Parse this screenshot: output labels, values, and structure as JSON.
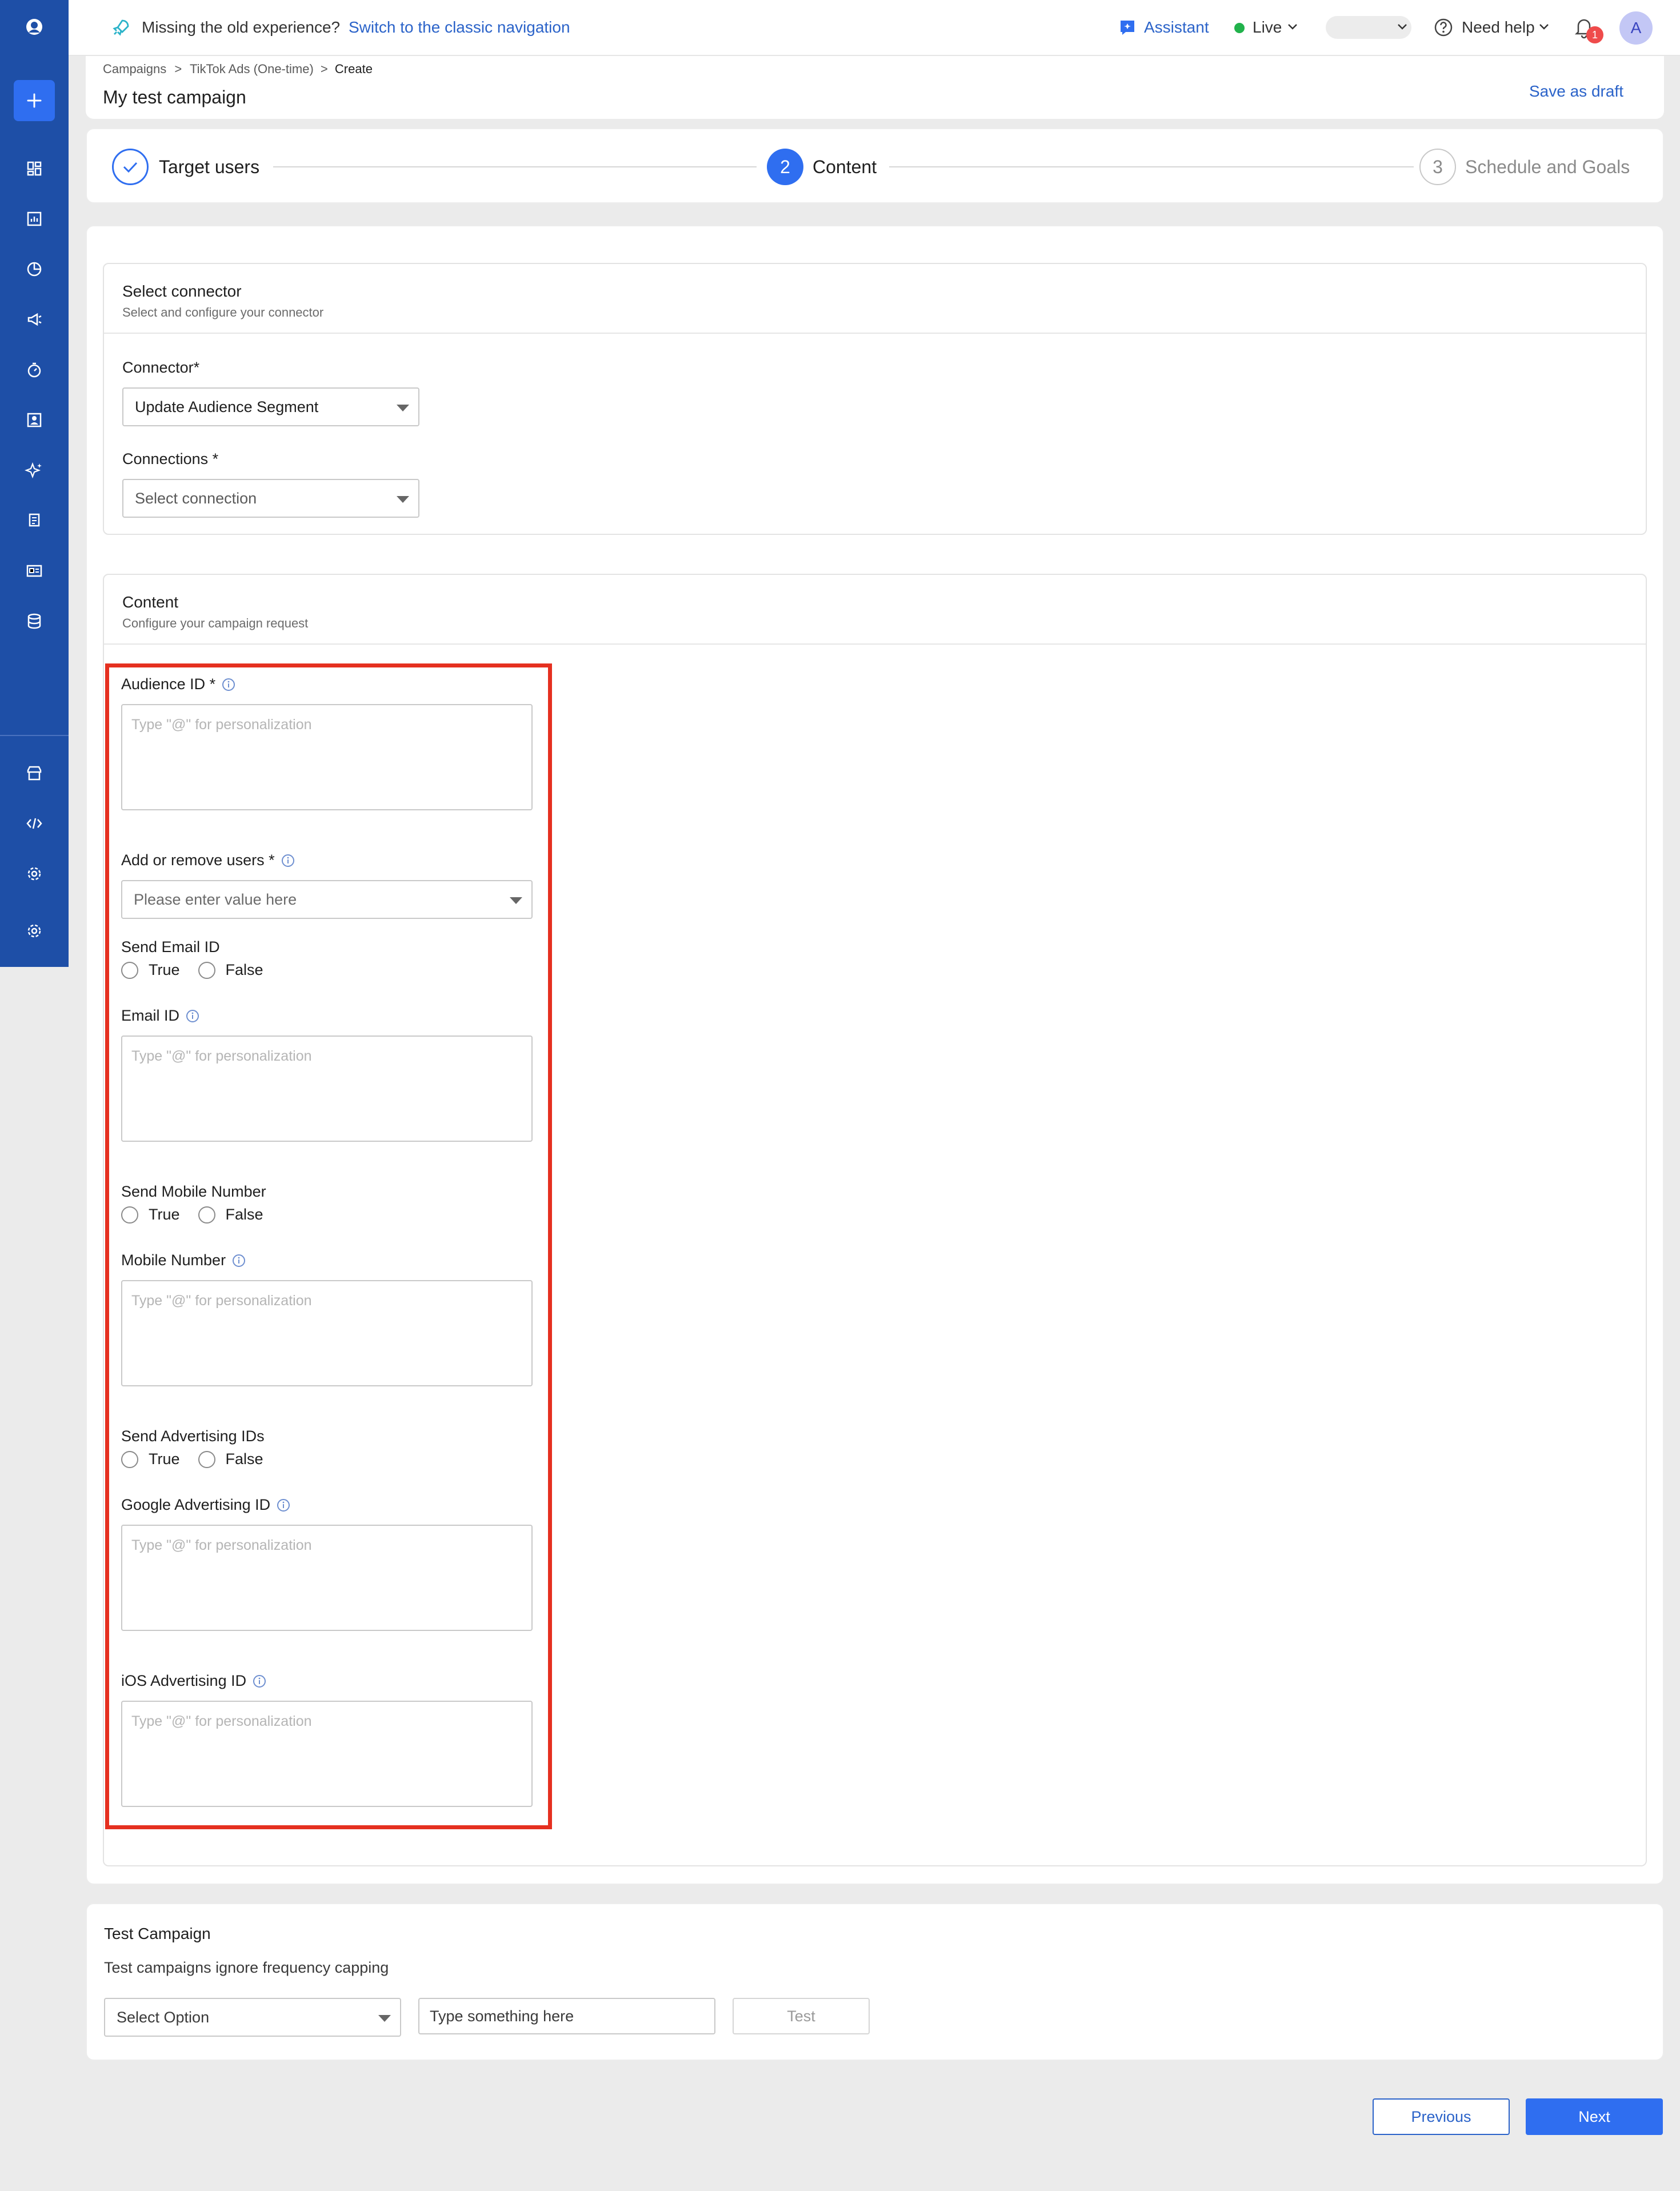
{
  "topbar": {
    "banner_text": "Missing the old experience?",
    "banner_link": "Switch to the classic navigation",
    "assistant_label": "Assistant",
    "env_label": "Live",
    "help_label": "Need help",
    "notification_count": "1",
    "avatar_initial": "A"
  },
  "header": {
    "breadcrumb": [
      "Campaigns",
      "TikTok Ads (One-time)",
      "Create"
    ],
    "breadcrumb_sep": ">",
    "title": "My test campaign",
    "save_draft": "Save as draft"
  },
  "stepper": {
    "steps": [
      {
        "number": "",
        "label": "Target users",
        "state": "done"
      },
      {
        "number": "2",
        "label": "Content",
        "state": "active"
      },
      {
        "number": "3",
        "label": "Schedule and Goals",
        "state": "upcoming"
      }
    ]
  },
  "connector_section": {
    "title": "Select connector",
    "subtitle": "Select and configure your connector",
    "connector_label": "Connector*",
    "connector_value": "Update Audience Segment",
    "connections_label": "Connections *",
    "connections_value": "Select connection"
  },
  "content_section": {
    "title": "Content",
    "subtitle": "Configure your campaign request",
    "placeholder": "Type \"@\" for personalization",
    "audience_id_label": "Audience ID *",
    "add_remove_label": "Add or remove users *",
    "add_remove_placeholder": "Please enter value here",
    "send_email_label": "Send Email ID",
    "email_id_label": "Email ID",
    "send_mobile_label": "Send Mobile Number",
    "mobile_label": "Mobile Number",
    "send_adv_label": "Send Advertising IDs",
    "google_adv_label": "Google Advertising ID",
    "ios_adv_label": "iOS Advertising ID",
    "true_label": "True",
    "false_label": "False"
  },
  "test_campaign": {
    "title": "Test Campaign",
    "subtitle": "Test campaigns ignore frequency capping",
    "select_placeholder": "Select Option",
    "input_placeholder": "Type something here",
    "test_button": "Test"
  },
  "footer": {
    "previous": "Previous",
    "next": "Next"
  },
  "colors": {
    "sidebar": "#1e4fa7",
    "primary": "#2f6ef0",
    "link": "#2b63c9",
    "highlight": "#e53020"
  }
}
